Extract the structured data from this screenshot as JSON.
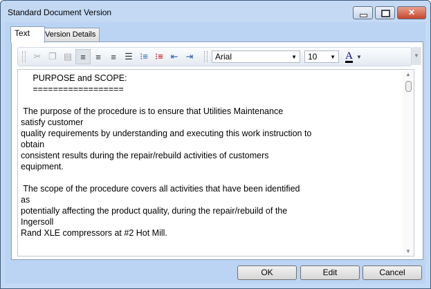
{
  "window": {
    "title": "Standard Document Version"
  },
  "tabs": [
    {
      "label": "Text"
    },
    {
      "label": "Version Details"
    }
  ],
  "toolbar": {
    "font": "Arial",
    "size": "10",
    "font_color_label": "A",
    "font_color": "#00008b",
    "icons": [
      "cut-icon",
      "copy-icon",
      "paste-icon",
      "align-left-icon",
      "align-center-icon",
      "align-right-icon",
      "justify-icon",
      "bullet-list-icon",
      "numbered-list-icon",
      "outdent-icon",
      "indent-icon"
    ]
  },
  "document": {
    "text": "     PURPOSE and SCOPE:\n     ==================\n\n The purpose of the procedure is to ensure that Utilities Maintenance\nsatisfy customer\nquality requirements by understanding and executing this work instruction to\nobtain\nconsistent results during the repair/rebuild activities of customers\nequipment.\n\n The scope of the procedure covers all activities that have been identified\nas\npotentially affecting the product quality, during the repair/rebuild of the\nIngersoll\nRand XLE compressors at #2 Hot Mill."
  },
  "buttons": {
    "ok": "OK",
    "edit": "Edit",
    "cancel": "Cancel"
  }
}
